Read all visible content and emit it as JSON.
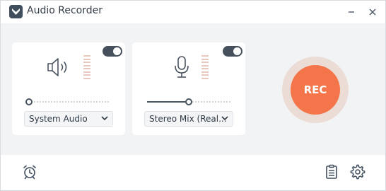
{
  "titlebar": {
    "title": "Audio Recorder",
    "logo_icon": "heart-shield-icon",
    "minimize_icon": "minimize-icon",
    "close_icon": "close-icon"
  },
  "system_audio": {
    "icon": "speaker-icon",
    "enabled": true,
    "volume": 0.0,
    "selected_device": "System Audio"
  },
  "microphone": {
    "icon": "microphone-icon",
    "enabled": true,
    "volume": 0.5,
    "selected_device": "Stereo Mix (Real..."
  },
  "record_button": {
    "label": "REC",
    "color": "#f4754a"
  },
  "footer": {
    "schedule_icon": "alarm-clock-icon",
    "history_icon": "clipboard-list-icon",
    "settings_icon": "gear-icon"
  }
}
